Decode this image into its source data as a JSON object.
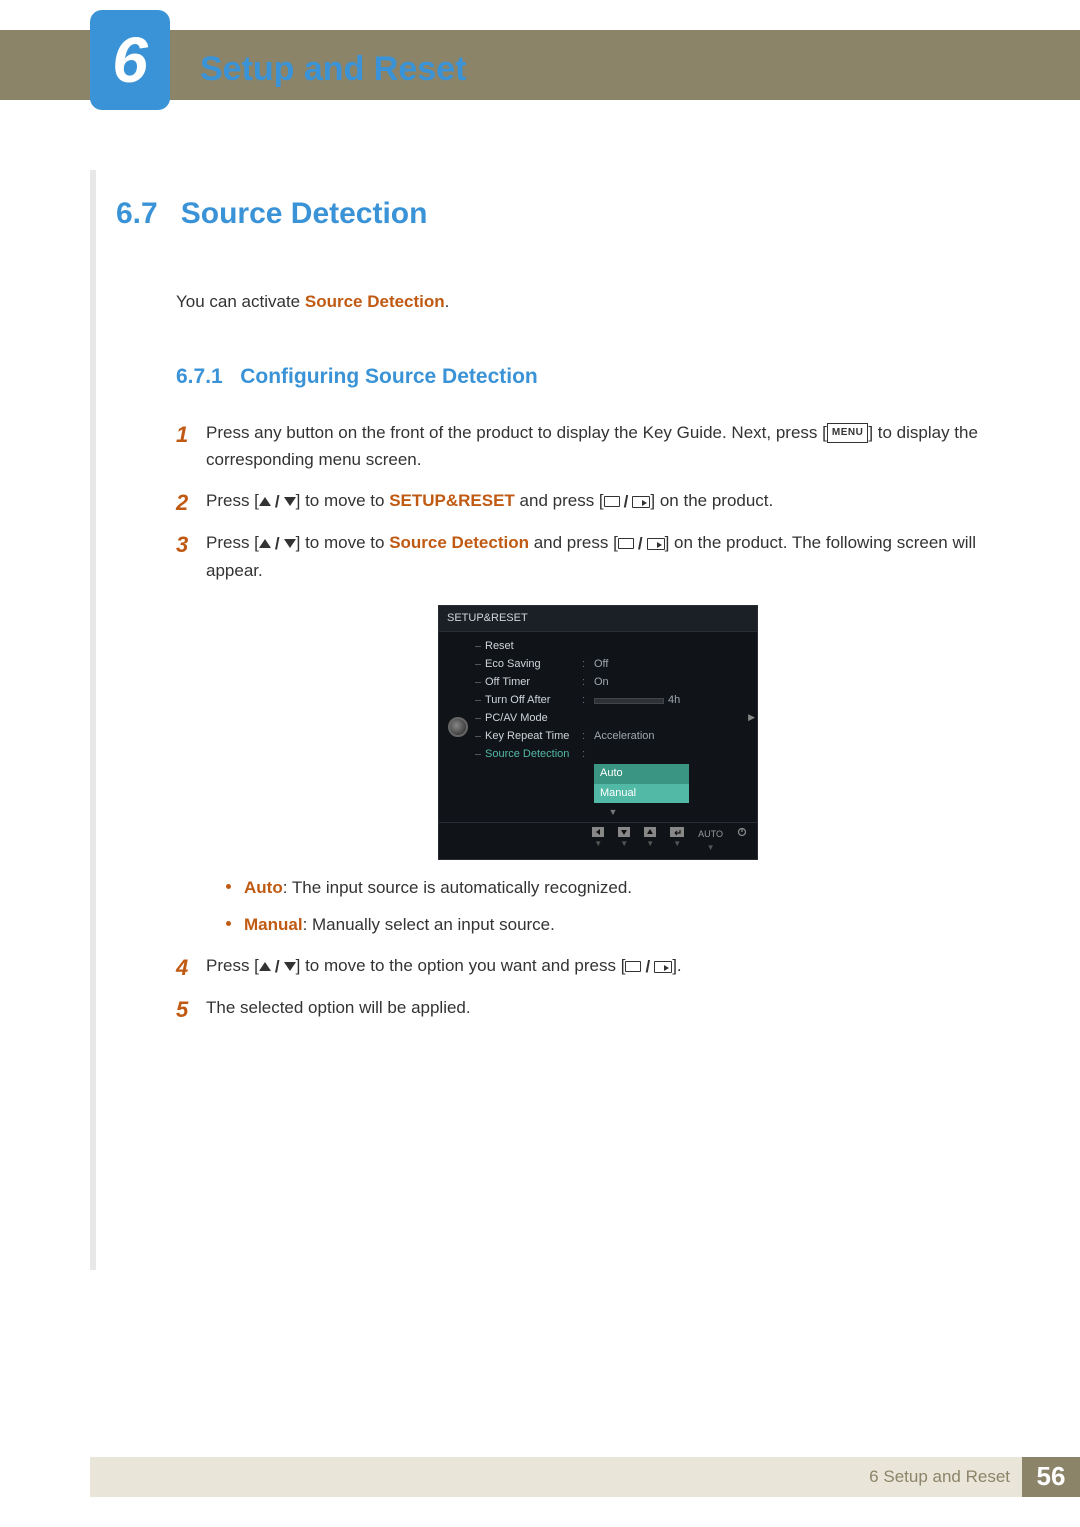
{
  "header": {
    "chapter_number": "6",
    "chapter_title": "Setup and Reset"
  },
  "section": {
    "number": "6.7",
    "title": "Source Detection"
  },
  "intro": {
    "prefix": "You can activate ",
    "highlight": "Source Detection",
    "suffix": "."
  },
  "subsection": {
    "number": "6.7.1",
    "title": "Configuring Source Detection"
  },
  "steps": {
    "s1a": "Press any button on the front of the product to display the Key Guide. Next, press [",
    "s1_menu": "MENU",
    "s1b": "] to display the corresponding menu screen.",
    "s2a": "Press [",
    "s2b": "] to move to ",
    "s2_hl": "SETUP&RESET",
    "s2c": " and press [",
    "s2d": "] on the product.",
    "s3a": "Press [",
    "s3b": "] to move to ",
    "s3_hl": "Source Detection",
    "s3c": " and press [",
    "s3d": "] on the product. The following screen will appear.",
    "s4a": "Press [",
    "s4b": "] to move to the option you want and press [",
    "s4c": "].",
    "s5": "The selected option will be applied."
  },
  "osd": {
    "title": "SETUP&RESET",
    "rows": {
      "reset": "Reset",
      "eco": "Eco Saving",
      "eco_v": "Off",
      "timer": "Off Timer",
      "timer_v": "On",
      "turnoff": "Turn Off After",
      "turnoff_v": "4h",
      "pcav": "PC/AV Mode",
      "krt": "Key Repeat Time",
      "krt_v": "Acceleration",
      "source": "Source Detection"
    },
    "options": {
      "auto": "Auto",
      "manual": "Manual"
    },
    "footer": {
      "auto": "AUTO"
    }
  },
  "bullets": {
    "auto_label": "Auto",
    "auto_text": ": The input source is automatically recognized.",
    "manual_label": "Manual",
    "manual_text": ": Manually select an input source."
  },
  "footer": {
    "text": "6 Setup and Reset",
    "page": "56"
  }
}
